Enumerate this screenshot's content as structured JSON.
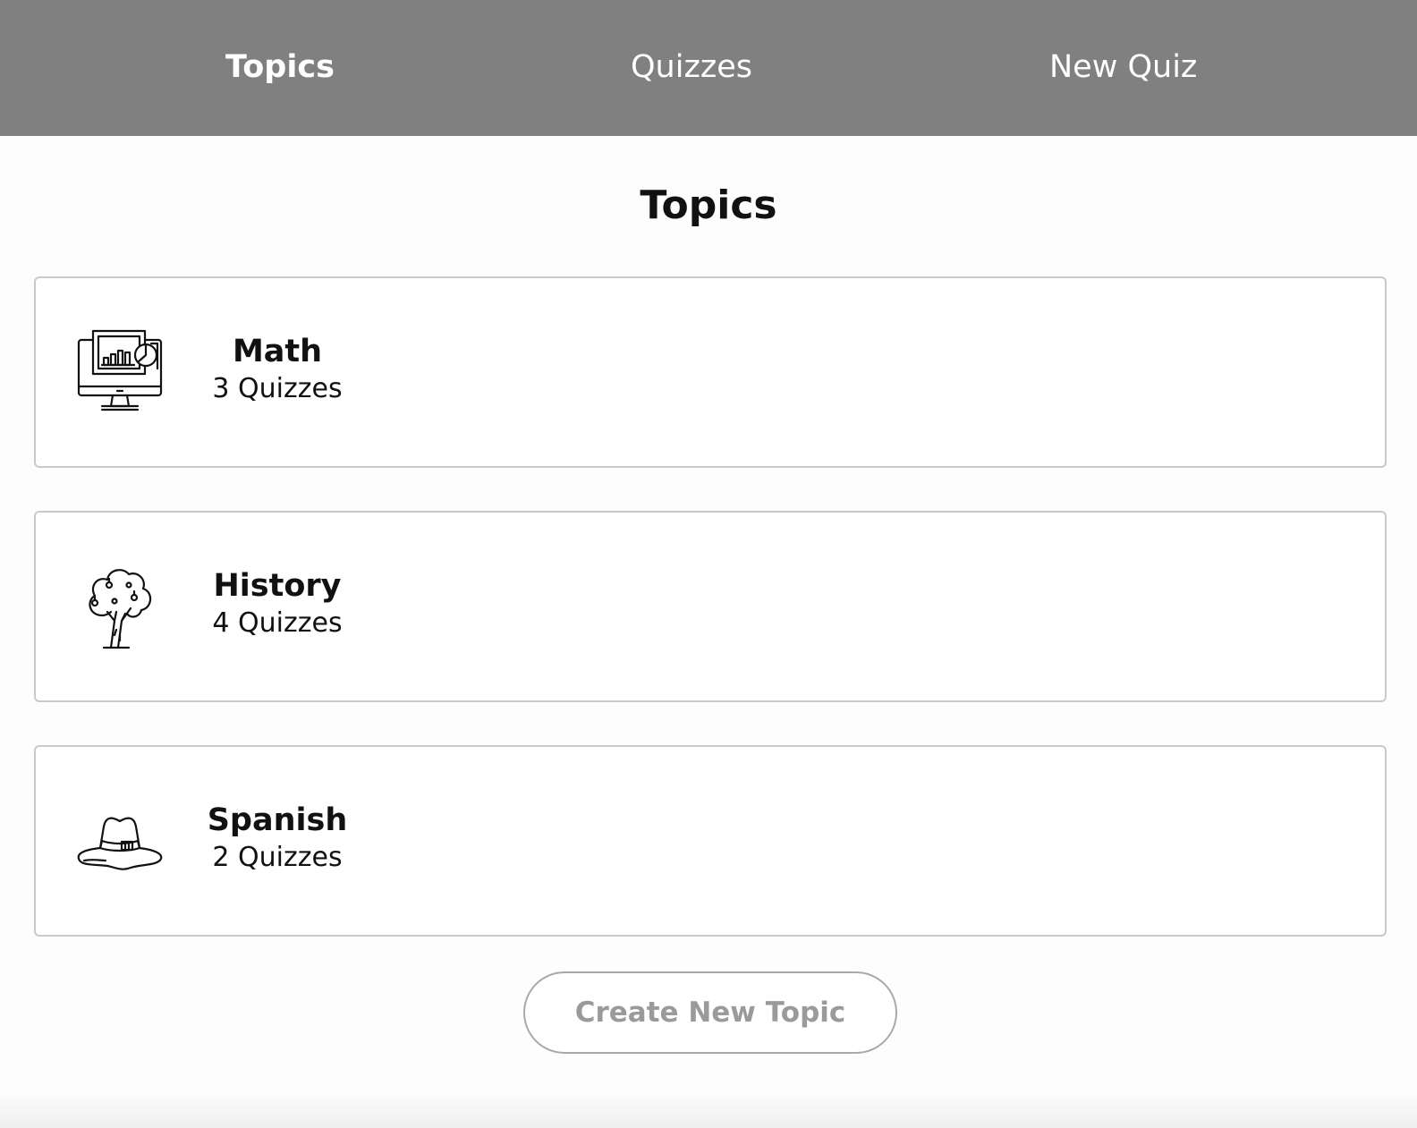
{
  "nav": {
    "items": [
      {
        "label": "Topics",
        "active": true
      },
      {
        "label": "Quizzes",
        "active": false
      },
      {
        "label": "New Quiz",
        "active": false
      }
    ]
  },
  "main": {
    "title": "Topics",
    "topics": [
      {
        "name": "Math",
        "quiz_count": "3 Quizzes",
        "icon": "computer-chart-icon"
      },
      {
        "name": "History",
        "quiz_count": "4 Quizzes",
        "icon": "tree-icon"
      },
      {
        "name": "Spanish",
        "quiz_count": "2 Quizzes",
        "icon": "hat-icon"
      }
    ],
    "create_button_label": "Create New Topic"
  },
  "colors": {
    "navbar_bg": "#808080",
    "nav_text": "#ffffff",
    "card_border": "#c9c9c9",
    "button_text": "#9a9a9a"
  }
}
